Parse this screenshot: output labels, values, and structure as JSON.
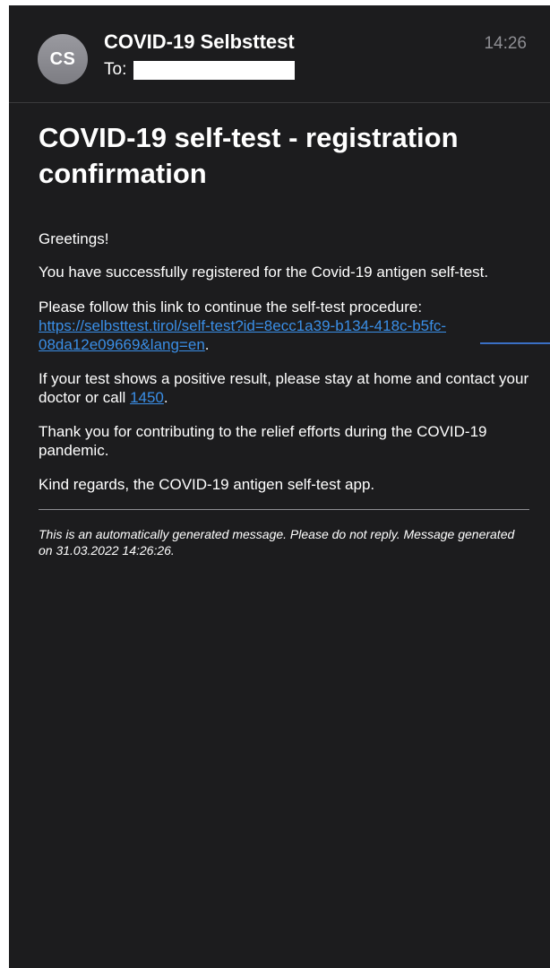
{
  "header": {
    "avatar_initials": "CS",
    "sender": "COVID-19 Selbsttest",
    "to_label": "To:",
    "time": "14:26"
  },
  "message": {
    "subject": "COVID-19 self-test - registration confirmation",
    "greeting": "Greetings!",
    "registered": "You have successfully registered for the Covid-19 antigen self-test.",
    "link_intro": "Please follow this link to continue the self-test procedure:",
    "link_url": "https://selbsttest.tirol/self-test?id=8ecc1a39-b134-418c-b5fc-08da12e09669&lang=en",
    "link_after": ".",
    "positive_text": "If your test shows a positive result, please stay at home and contact your doctor or call",
    "phone": "1450",
    "positive_after": ".",
    "thanks": "Thank you for contributing to the relief efforts during the COVID-19 pandemic.",
    "regards": "Kind regards, the COVID-19 antigen self-test app.",
    "auto_note": "This is an automatically generated message. Please do not reply. Message generated on 31.03.2022 14:26:26."
  },
  "colors": {
    "background": "#1c1c1e",
    "link": "#3a8ee6",
    "secondary_text": "#8e8e93"
  }
}
